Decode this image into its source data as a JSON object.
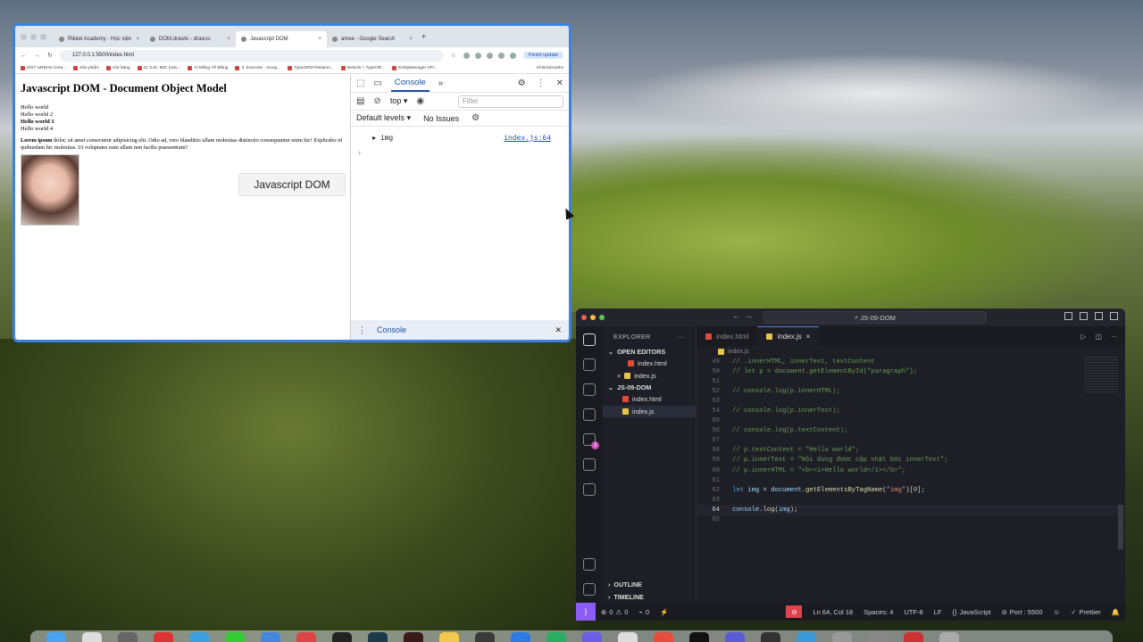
{
  "browser": {
    "tabs": [
      {
        "label": "Rikkei Academy - Học viện",
        "active": false
      },
      {
        "label": "DOM.drawio - draw.io",
        "active": false
      },
      {
        "label": "Javascript DOM",
        "active": true
      },
      {
        "label": "amee - Google Search",
        "active": false
      }
    ],
    "new_tab": "+",
    "url": "127.0.0.1:5500/index.html",
    "finish_update": "Finish update",
    "bookmarks": [
      "ZIST URBAN Crea...",
      "Sản phẩm",
      "Giỏ hàng",
      "21 SJS, 80C (ndu...",
      "Ai Mắng Yể Mắng",
      "3. Exercise - Goog...",
      "TypeORM Relation...",
      "NestJS + TypeOR...",
      "EntityManager API..."
    ],
    "all_bookmarks": "All Bookmarks"
  },
  "page": {
    "title": "Javascript DOM - Document Object Model",
    "lines": [
      "Hello world",
      "Hello world 2",
      "Hello world 3",
      "Hello world 4"
    ],
    "para_bold": "Lorem ipsum",
    "para_rest": " dolor, sit amet consectetur adipisicing elit. Odio ad, vero blanditiis ullam molestias distinctio consequuntur enim hic! Explicabo id quibusdam hic molestias. Ut voluptates eum ullam non facilis praesentium?",
    "button_label": "Javascript DOM"
  },
  "devtools": {
    "tab_console": "Console",
    "context": "top",
    "filter_placeholder": "Filter",
    "default_levels": "Default levels",
    "no_issues": "No Issues",
    "log_value": "img",
    "log_source": "index.js:64",
    "drawer_label": "Console"
  },
  "vscode": {
    "search": "JS-09-DOM",
    "explorer_title": "EXPLORER",
    "open_editors": "OPEN EDITORS",
    "open_files": [
      "index.html",
      "index.js"
    ],
    "project": "JS-09-DOM",
    "project_files": [
      "index.html",
      "index.js"
    ],
    "outline": "OUTLINE",
    "timeline": "TIMELINE",
    "editor_tabs": [
      "index.html",
      "index.js"
    ],
    "breadcrumb": "index.js",
    "code_lines": [
      {
        "n": "49",
        "t": "// .innerHTML, innerText, textContent"
      },
      {
        "n": "50",
        "t": "// let p = document.getElementById(\"paragraph\");"
      },
      {
        "n": "51",
        "t": ""
      },
      {
        "n": "52",
        "t": "// console.log(p.innerHTML);"
      },
      {
        "n": "53",
        "t": ""
      },
      {
        "n": "54",
        "t": "// console.log(p.innerText);"
      },
      {
        "n": "55",
        "t": ""
      },
      {
        "n": "56",
        "t": "// console.log(p.textContent);"
      },
      {
        "n": "57",
        "t": ""
      },
      {
        "n": "58",
        "t": "// p.textContent = \"Hello world\";"
      },
      {
        "n": "59",
        "t": "// p.innerText = \"Nội dung được cập nhật bởi innerText\";"
      },
      {
        "n": "60",
        "t": "// p.innerHTML = \"<b><i>Hello world</i></b>\";"
      },
      {
        "n": "61",
        "t": ""
      },
      {
        "n": "62",
        "t": "let img = document.getElementsByTagName(\"img\")[0];"
      },
      {
        "n": "63",
        "t": ""
      },
      {
        "n": "64",
        "t": "console.log(img);"
      },
      {
        "n": "65",
        "t": ""
      }
    ],
    "status": {
      "errors": "0",
      "warnings": "0",
      "ports": "0",
      "position": "Ln 64, Col 18",
      "spaces": "Spaces: 4",
      "encoding": "UTF-8",
      "eol": "LF",
      "language": "JavaScript",
      "port": "Port : 5500",
      "prettier": "Prettier"
    },
    "source_control_badge": "3"
  }
}
